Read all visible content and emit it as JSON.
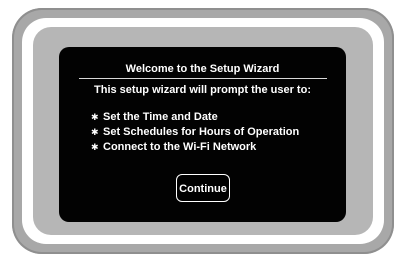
{
  "wizard": {
    "title": "Welcome to the Setup Wizard",
    "intro": "This setup wizard will prompt the user to:",
    "bullet_icon": "asterisk-bullet-icon",
    "items": [
      {
        "label": "Set the Time and Date"
      },
      {
        "label": "Set Schedules for Hours of Operation"
      },
      {
        "label": "Connect to the Wi-Fi Network"
      }
    ],
    "continue_label": "Continue"
  },
  "colors": {
    "screen_background": "#020202",
    "text": "#ffffff",
    "bezel": "#b6b6b6",
    "frame": "#a8a8a8"
  }
}
